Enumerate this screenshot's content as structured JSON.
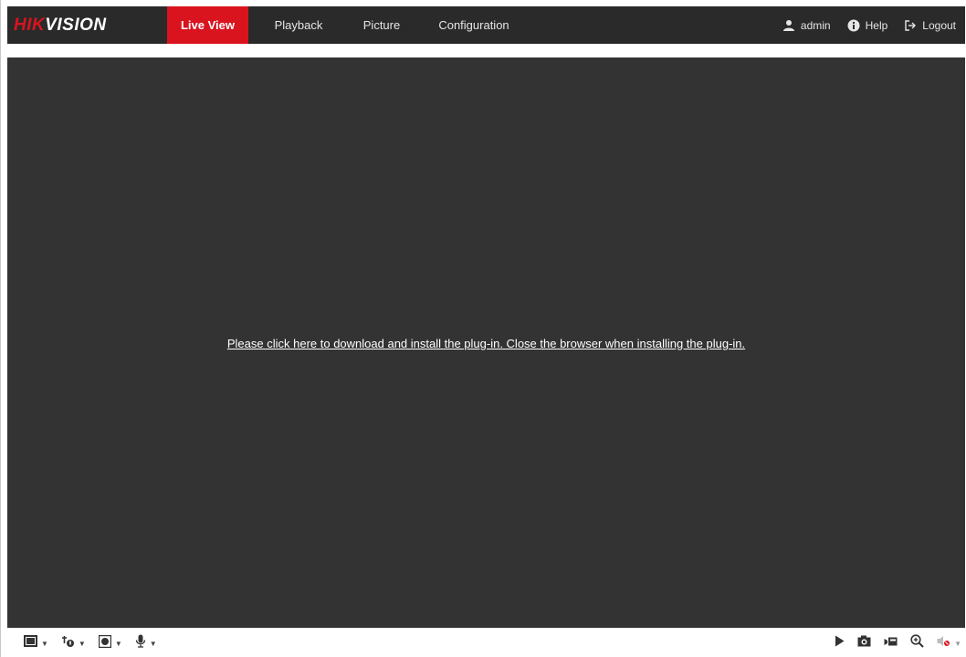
{
  "brand": {
    "logo_part1": "HIK",
    "logo_part2": "VISION",
    "logo_red": "#d9141f"
  },
  "nav": {
    "tabs": [
      {
        "label": "Live View",
        "active": true
      },
      {
        "label": "Playback",
        "active": false
      },
      {
        "label": "Picture",
        "active": false
      },
      {
        "label": "Configuration",
        "active": false
      }
    ]
  },
  "user": {
    "username": "admin",
    "help_label": "Help",
    "logout_label": "Logout",
    "icons": [
      "user-icon",
      "help-icon",
      "logout-icon"
    ]
  },
  "video": {
    "plugin_message": "Please click here to download and install the plug-in. Close the browser when installing the plug-in.",
    "background": "#333333"
  },
  "toolbar": {
    "left_icons": [
      "window-layout-icon",
      "stream-type-icon",
      "plugin-type-icon",
      "microphone-icon"
    ],
    "right_icons": [
      "play-icon",
      "snapshot-icon",
      "record-icon",
      "digital-zoom-icon",
      "volume-icon"
    ]
  },
  "colors": {
    "topbar": "#2a2a2a",
    "accent": "#d9141f",
    "toolbar_icon": "#333333"
  }
}
